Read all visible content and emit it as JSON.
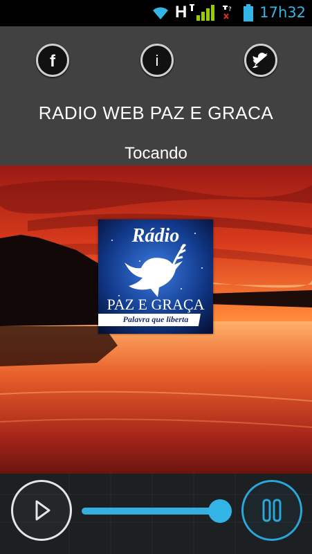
{
  "status_bar": {
    "network_label": "H",
    "time": "17h32",
    "icons": [
      "wifi-icon",
      "signal-icon",
      "no-sim-icon",
      "battery-icon"
    ]
  },
  "header": {
    "social_buttons": [
      {
        "label": "f",
        "icon": "facebook-icon"
      },
      {
        "label": "i",
        "icon": "info-icon"
      },
      {
        "label": "",
        "icon": "twitter-icon"
      }
    ],
    "title": "RADIO WEB PAZ E GRACA",
    "status": "Tocando"
  },
  "logo": {
    "line1": "Rádio",
    "line2": "PAZ E GRAÇA",
    "slogan": "Palavra que liberta"
  },
  "player": {
    "play_icon": "play-icon",
    "pause_icon": "pause-icon",
    "volume_level": 0.95
  },
  "colors": {
    "accent": "#33b5e5",
    "topbar": "#414141",
    "controls": "#1d2022"
  }
}
